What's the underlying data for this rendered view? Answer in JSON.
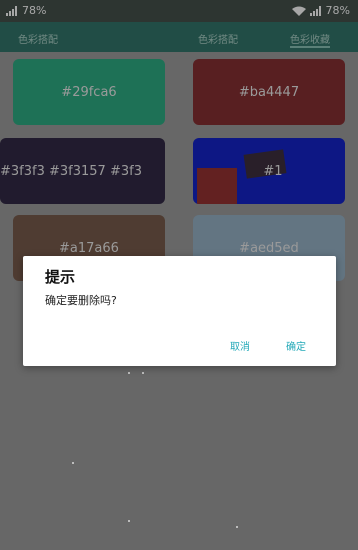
{
  "status_bar": {
    "left_battery": "78%",
    "right_battery": "78%"
  },
  "tabs": [
    {
      "label": "色彩搭配"
    },
    {
      "label": "色彩搭配"
    },
    {
      "label": "色彩收藏"
    }
  ],
  "colors": [
    {
      "label": "#29fca6",
      "color": "#2a9d78"
    },
    {
      "label": "#ba4447",
      "color": "#7a2c2e"
    },
    {
      "label": "#3f3f3 #3f3157 #3f3",
      "color": "#2f2640"
    },
    {
      "label": "#1",
      "color": "#1220b8"
    },
    {
      "label": "#a17a66",
      "color": "#6e5446"
    },
    {
      "label": "#aed5ed",
      "color": "#8aa2b5"
    }
  ],
  "dialog": {
    "title": "提示",
    "message": "确定要删除吗?",
    "cancel_label": "取消",
    "confirm_label": "确定"
  }
}
